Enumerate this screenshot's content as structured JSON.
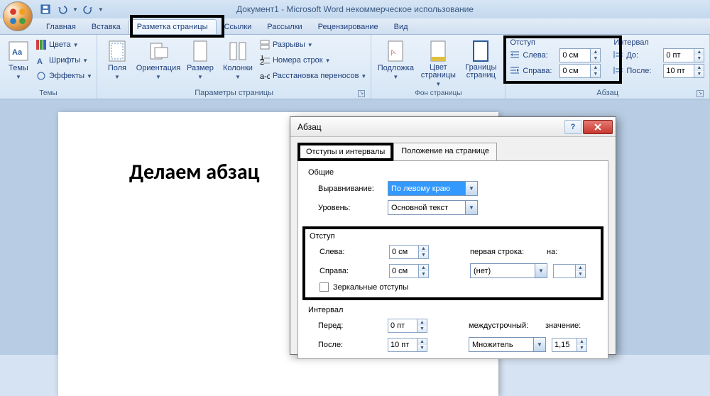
{
  "title": "Документ1 - Microsoft Word некоммерческое использование",
  "tabs": {
    "home": "Главная",
    "insert": "Вставка",
    "layout": "Разметка страницы",
    "refs": "Ссылки",
    "mail": "Рассылки",
    "review": "Рецензирование",
    "view": "Вид"
  },
  "ribbon": {
    "themes": {
      "btn": "Темы",
      "colors": "Цвета",
      "fonts": "Шрифты",
      "effects": "Эффекты",
      "label": "Темы"
    },
    "page": {
      "margins": "Поля",
      "orient": "Ориентация",
      "size": "Размер",
      "cols": "Колонки",
      "breaks": "Разрывы",
      "lines": "Номера строк",
      "hyph": "Расстановка переносов",
      "label": "Параметры страницы"
    },
    "bg": {
      "water": "Подложка",
      "color": "Цвет\nстраницы",
      "border": "Границы\nстраниц",
      "label": "Фон страницы"
    },
    "para": {
      "indent": "Отступ",
      "left": "Слева:",
      "right": "Справа:",
      "leftv": "0 см",
      "rightv": "0 см",
      "spacing": "Интервал",
      "before": "До:",
      "after": "После:",
      "beforev": "0 пт",
      "afterv": "10 пт",
      "label": "Абзац"
    }
  },
  "doc": {
    "text": "Делаем абзац"
  },
  "dialog": {
    "title": "Абзац",
    "tab1": "Отступы и интервалы",
    "tab2": "Положение на странице",
    "general": "Общие",
    "align": "Выравнивание:",
    "alignv": "По левому краю",
    "level": "Уровень:",
    "levelv": "Основной текст",
    "indent": "Отступ",
    "left": "Слева:",
    "leftv": "0 см",
    "right": "Справа:",
    "rightv": "0 см",
    "first": "первая строка:",
    "firstv": "(нет)",
    "by": "на:",
    "mirror": "Зеркальные отступы",
    "spacing": "Интервал",
    "before": "Перед:",
    "beforev": "0 пт",
    "after": "После:",
    "afterv": "10 пт",
    "line": "междустрочный:",
    "linev": "Множитель",
    "at": "значение:",
    "atv": "1,15"
  }
}
